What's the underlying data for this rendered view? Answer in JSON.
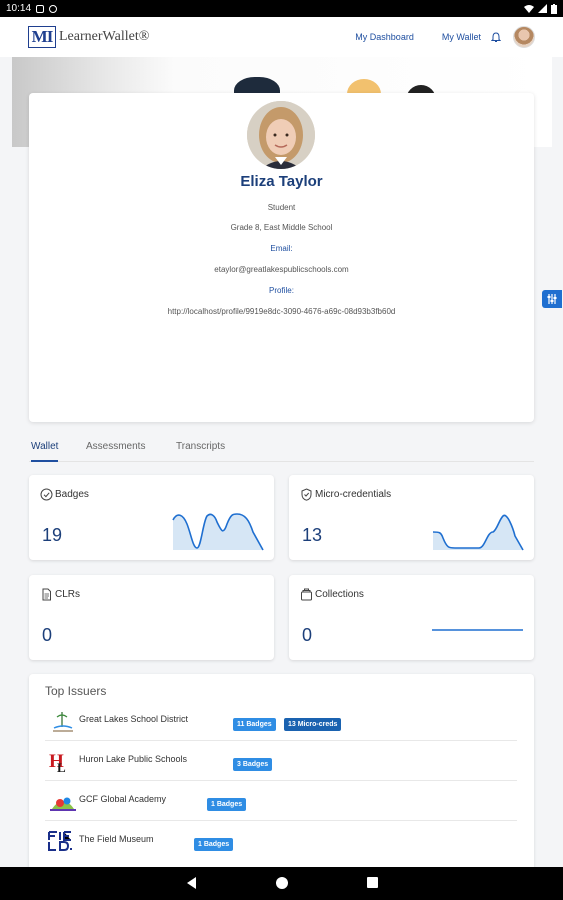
{
  "status_bar": {
    "time": "10:14"
  },
  "header": {
    "logo_mark": "MI",
    "logo_text": "LearnerWallet®",
    "nav_dashboard": "My Dashboard",
    "nav_wallet": "My Wallet"
  },
  "profile": {
    "name": "Eliza Taylor",
    "role": "Student",
    "school": "Grade 8, East Middle School",
    "email_label": "Email:",
    "email": "etaylor@greatlakespublicschools.com",
    "profile_label": "Profile:",
    "profile_url": "http://localhost/profile/9919e8dc-3090-4676-a69c-08d93b3fb60d"
  },
  "tabs": [
    {
      "label": "Wallet",
      "active": true
    },
    {
      "label": "Assessments",
      "active": false
    },
    {
      "label": "Transcripts",
      "active": false
    }
  ],
  "stats": [
    {
      "label": "Badges",
      "value": "19",
      "icon": "badge-check-icon"
    },
    {
      "label": "Micro-credentials",
      "value": "13",
      "icon": "shield-check-icon"
    },
    {
      "label": "CLRs",
      "value": "0",
      "icon": "document-icon"
    },
    {
      "label": "Collections",
      "value": "0",
      "icon": "folder-stack-icon"
    }
  ],
  "top_issuers": {
    "title": "Top Issuers",
    "items": [
      {
        "name": "Great Lakes School District",
        "badges": [
          "11 Badges",
          "13 Micro-creds"
        ]
      },
      {
        "name": "Huron Lake Public Schools",
        "badges": [
          "3 Badges"
        ]
      },
      {
        "name": "GCF Global Academy",
        "badges": [
          "1 Badges"
        ]
      },
      {
        "name": "The Field Museum",
        "badges": [
          "1 Badges"
        ]
      }
    ]
  },
  "colors": {
    "primary": "#1f4fa0",
    "badge_blue": "#2f8de4",
    "chart_fill": "#d6e6f5"
  }
}
